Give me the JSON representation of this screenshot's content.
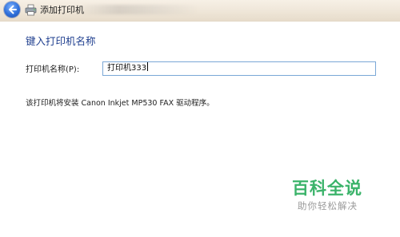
{
  "window": {
    "title": "添加打印机"
  },
  "page": {
    "heading": "键入打印机名称",
    "printer_name_label": "打印机名称(P):",
    "printer_name_value": "打印机333",
    "driver_info": "该打印机将安装 Canon Inkjet MP530 FAX 驱动程序。"
  },
  "watermark": {
    "title": "百科全说",
    "subtitle": "助你轻松解决"
  },
  "colors": {
    "heading": "#1f3f8f",
    "input_border": "#7aa7d6",
    "watermark_green": "#3bb36a"
  }
}
